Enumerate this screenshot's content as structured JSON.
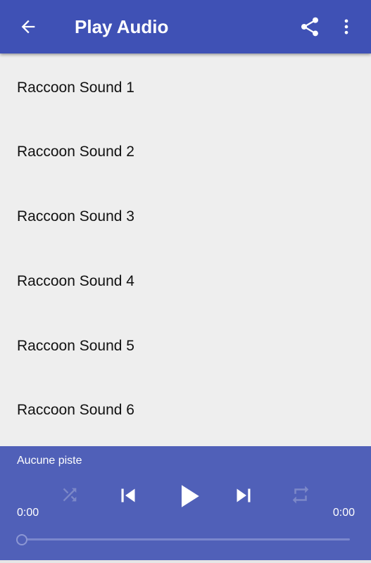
{
  "toolbar": {
    "title": "Play Audio",
    "background_color": "#3f51b5",
    "back_icon": "arrow-left-icon",
    "share_icon": "share-icon",
    "more_icon": "more-vertical-icon"
  },
  "list": {
    "items": [
      {
        "label": "Raccoon Sound 1"
      },
      {
        "label": "Raccoon Sound 2"
      },
      {
        "label": "Raccoon Sound 3"
      },
      {
        "label": "Raccoon Sound 4"
      },
      {
        "label": "Raccoon Sound 5"
      },
      {
        "label": "Raccoon Sound 6"
      }
    ]
  },
  "player": {
    "track_name": "Aucune piste",
    "current_time": "0:00",
    "total_time": "0:00",
    "progress": 0,
    "background_color": "#5060b8",
    "controls": [
      "shuffle-icon",
      "skip-previous-icon",
      "play-icon",
      "skip-next-icon",
      "repeat-icon"
    ]
  }
}
